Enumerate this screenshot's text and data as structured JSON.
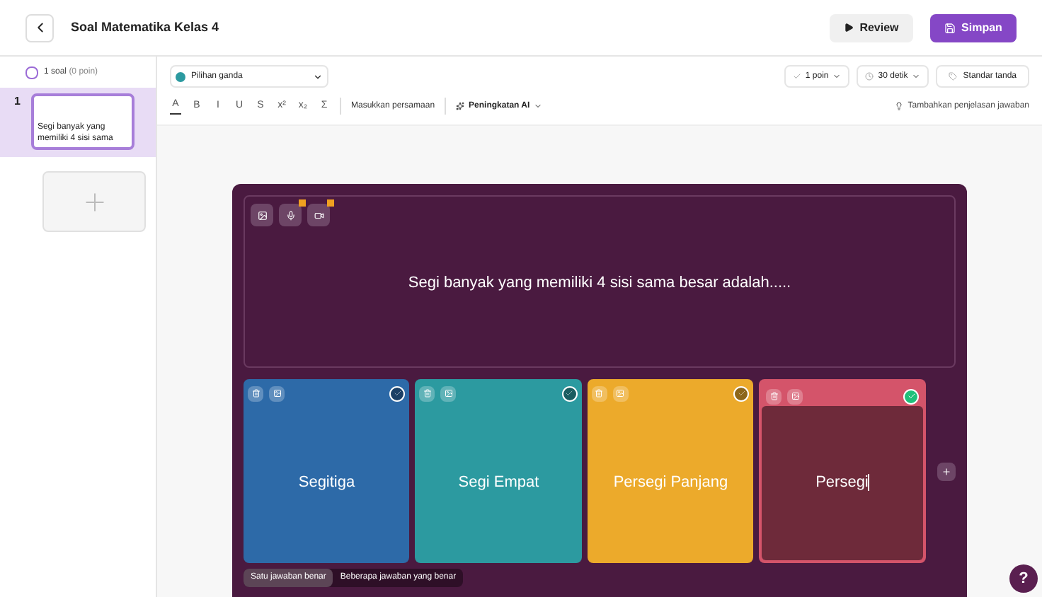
{
  "header": {
    "title": "Soal Matematika Kelas 4",
    "buttons": [
      {
        "label": "Review",
        "kind": "secondary"
      },
      {
        "label": "Simpan",
        "kind": "primary"
      }
    ]
  },
  "sidebar": {
    "summary": {
      "label": "1 soal",
      "points": "(0 poin)",
      "checked": false
    },
    "questions": [
      {
        "number": "1",
        "text": "Segi banyak yang memiliki 4 sisi sama",
        "selected": true
      }
    ]
  },
  "toolbar": {
    "question_type": "Pilihan ganda",
    "points": "1 poin",
    "time": "30 detik",
    "marking": "Standar tanda",
    "format_buttons": [
      "A",
      "B",
      "I",
      "U",
      "S",
      "x²",
      "x₂",
      "Σ"
    ],
    "equation": "Masukkan persamaan",
    "ai": "Peningkatan AI",
    "explanation": "Tambahkan penjelasan jawaban"
  },
  "question": {
    "text": "Segi banyak yang memiliki 4 sisi sama besar adalah....."
  },
  "options": [
    {
      "text": "Segitiga",
      "color": "#2d6aa8",
      "correct": false,
      "editing": false
    },
    {
      "text": "Segi Empat",
      "color": "#2c9aa0",
      "correct": false,
      "editing": false
    },
    {
      "text": "Persegi Panjang",
      "color": "#ecaa2b",
      "correct": false,
      "editing": false
    },
    {
      "text": "Persegi",
      "color": "#d4546a",
      "correct": true,
      "editing": true
    }
  ],
  "answer_mode": [
    {
      "label": "Satu jawaban benar",
      "selected": true
    },
    {
      "label": "Beberapa jawaban yang benar",
      "selected": false
    }
  ],
  "help": {
    "label": "?"
  }
}
